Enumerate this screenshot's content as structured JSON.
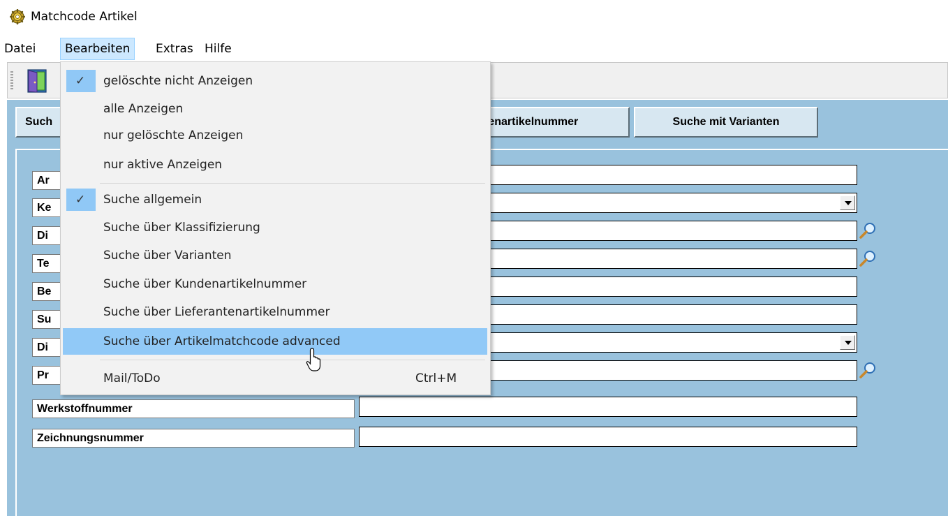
{
  "window": {
    "title": "Matchcode Artikel"
  },
  "menubar": {
    "items": [
      {
        "label": "Datei"
      },
      {
        "label": "Bearbeiten"
      },
      {
        "label": "Extras"
      },
      {
        "label": "Hilfe"
      }
    ]
  },
  "buttons": {
    "partial_left": "Such",
    "partial_kunden": "tenartikelnummer",
    "varianten": "Suche mit Varianten"
  },
  "fields": [
    {
      "label": "Ar"
    },
    {
      "label": "Ke"
    },
    {
      "label": "Di"
    },
    {
      "label": "Te"
    },
    {
      "label": "Be"
    },
    {
      "label": "Su"
    },
    {
      "label": "Di"
    },
    {
      "label": "Pr"
    },
    {
      "label": "Werkstoffnummer"
    },
    {
      "label": "Zeichnungsnummer"
    }
  ],
  "dropdown": {
    "items": [
      {
        "label": "gelöschte nicht Anzeigen",
        "checked": true
      },
      {
        "label": "alle Anzeigen"
      },
      {
        "label": "nur gelöschte Anzeigen"
      },
      {
        "label": "nur aktive Anzeigen"
      },
      {
        "label": "Suche allgemein",
        "checked": true
      },
      {
        "label": "Suche über Klassifizierung"
      },
      {
        "label": "Suche über Varianten"
      },
      {
        "label": "Suche über Kundenartikelnummer"
      },
      {
        "label": "Suche über Lieferantenartikelnummer"
      },
      {
        "label": "Suche über Artikelmatchcode advanced",
        "highlighted": true
      },
      {
        "label": "Mail/ToDo",
        "shortcut": "Ctrl+M"
      }
    ],
    "check_glyph": "✓"
  },
  "colors": {
    "panel": "#99c2dd",
    "button": "#d7e7f1",
    "menu_hover": "#91c9f7",
    "menu_active": "#cce8ff"
  }
}
